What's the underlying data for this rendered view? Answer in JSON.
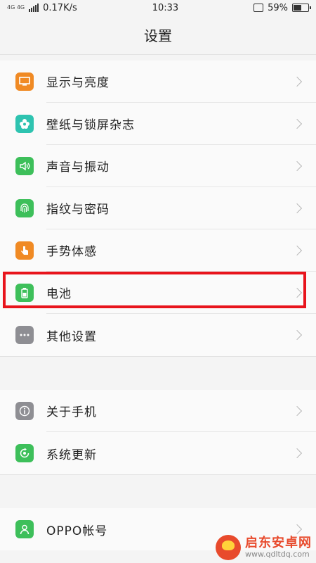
{
  "status_bar": {
    "net_type_top": "4G 4G",
    "speed": "0.17K/s",
    "time": "10:33",
    "battery_level": 0.59,
    "battery": "59%"
  },
  "header": {
    "title": "设置"
  },
  "groups": [
    {
      "items": [
        {
          "label": "显示与亮度",
          "icon": "display-icon",
          "color": "#f08a24"
        },
        {
          "label": "壁纸与锁屏杂志",
          "icon": "flower-icon",
          "color": "#2ec3b0"
        },
        {
          "label": "声音与振动",
          "icon": "speaker-icon",
          "color": "#3dbf5a"
        },
        {
          "label": "指纹与密码",
          "icon": "fingerprint-icon",
          "color": "#3dbf5a"
        },
        {
          "label": "手势体感",
          "icon": "hand-gesture-icon",
          "color": "#f08a24"
        },
        {
          "label": "电池",
          "icon": "battery-icon",
          "color": "#3dbf5a"
        },
        {
          "label": "其他设置",
          "icon": "more-dots-icon",
          "color": "#8e8e93"
        }
      ]
    },
    {
      "items": [
        {
          "label": "关于手机",
          "icon": "info-icon",
          "color": "#8e8e93"
        },
        {
          "label": "系统更新",
          "icon": "update-icon",
          "color": "#3dbf5a"
        }
      ]
    },
    {
      "items": [
        {
          "label": "OPPO帐号",
          "icon": "account-icon",
          "color": "#3dbf5a"
        }
      ]
    }
  ],
  "watermark": {
    "title": "启东安卓网",
    "url": "www.qdltdq.com"
  },
  "colors": {
    "highlight": "#e8141c"
  }
}
